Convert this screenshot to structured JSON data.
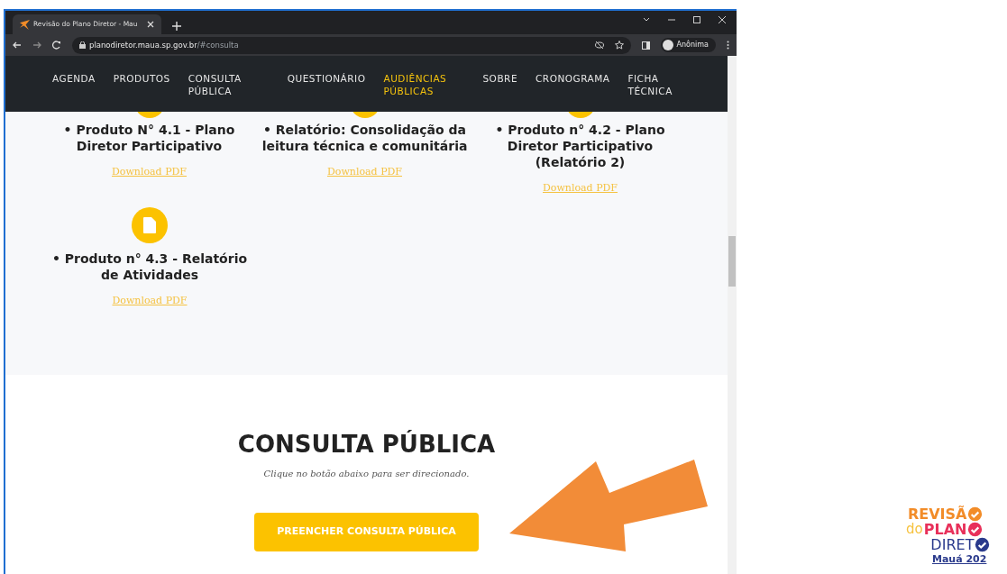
{
  "browser": {
    "tab_title": "Revisão do Plano Diretor - Mau",
    "url_host": "planodiretor.maua.sp.gov.br",
    "url_path": "/#consulta",
    "profile": "Anônima"
  },
  "nav": [
    {
      "label": "AGENDA",
      "selected": false
    },
    {
      "label": "PRODUTOS",
      "selected": false
    },
    {
      "label": "CONSULTA PÚBLICA",
      "selected": false
    },
    {
      "label": "QUESTIONÁRIO",
      "selected": false
    },
    {
      "label": "AUDIÊNCIAS PÚBLICAS",
      "selected": true
    },
    {
      "label": "SOBRE",
      "selected": false
    },
    {
      "label": "CRONOGRAMA",
      "selected": false
    },
    {
      "label": "FICHA TÉCNICA",
      "selected": false
    }
  ],
  "products": [
    {
      "title": "• Produto N° 4.1 - Plano Diretor Participativo",
      "link": "Download PDF"
    },
    {
      "title": "• Relatório: Consolidação da leitura técnica e comunitária",
      "link": "Download PDF"
    },
    {
      "title": "• Produto n° 4.2 - Plano Diretor Participativo (Relatório 2)",
      "link": "Download PDF"
    },
    {
      "title": "• Produto n° 4.3 - Relatório de Atividades",
      "link": "Download PDF"
    }
  ],
  "consulta": {
    "heading": "CONSULTA PÚBLICA",
    "subtitle": "Clique no botão abaixo para ser direcionado.",
    "button": "PREENCHER CONSULTA PÚBLICA"
  },
  "logo": {
    "line_1": "REVISÃ",
    "line_2a": "do",
    "line_2b": "PLAN",
    "line_3": "DIRET",
    "line_4": "Mauá 202"
  }
}
